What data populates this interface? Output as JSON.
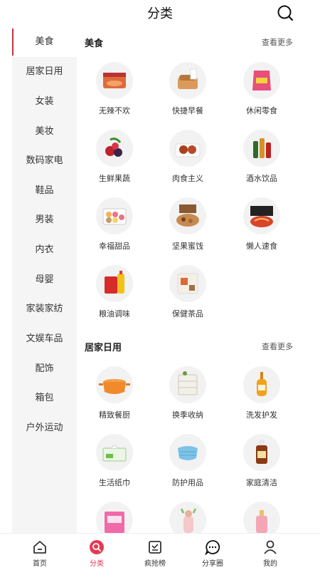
{
  "header": {
    "title": "分类"
  },
  "sidebar": {
    "items": [
      {
        "label": "美食",
        "active": true
      },
      {
        "label": "居家日用"
      },
      {
        "label": "女装"
      },
      {
        "label": "美妆"
      },
      {
        "label": "数码家电"
      },
      {
        "label": "鞋品"
      },
      {
        "label": "男装"
      },
      {
        "label": "内衣"
      },
      {
        "label": "母婴"
      },
      {
        "label": "家装家纺"
      },
      {
        "label": "文娱车品"
      },
      {
        "label": "配饰"
      },
      {
        "label": "箱包"
      },
      {
        "label": "户外运动"
      }
    ]
  },
  "sections": [
    {
      "title": "美食",
      "more": "查看更多",
      "items": [
        {
          "label": "无辣不欢",
          "icon": "spicy-food-icon"
        },
        {
          "label": "快捷早餐",
          "icon": "bread-icon"
        },
        {
          "label": "休闲零食",
          "icon": "snack-bag-icon"
        },
        {
          "label": "生鲜果蔬",
          "icon": "fruit-icon"
        },
        {
          "label": "肉食主义",
          "icon": "meatball-icon"
        },
        {
          "label": "酒水饮品",
          "icon": "bottles-icon"
        },
        {
          "label": "幸福甜品",
          "icon": "macaron-icon"
        },
        {
          "label": "坚果蜜饯",
          "icon": "nuts-icon"
        },
        {
          "label": "懒人速食",
          "icon": "instant-noodle-icon"
        },
        {
          "label": "粮油调味",
          "icon": "rice-oil-icon"
        },
        {
          "label": "保健茶品",
          "icon": "tea-box-icon"
        }
      ]
    },
    {
      "title": "居家日用",
      "more": "查看更多",
      "items": [
        {
          "label": "精致餐厨",
          "icon": "pot-icon"
        },
        {
          "label": "换季收纳",
          "icon": "drawer-icon"
        },
        {
          "label": "洗发护发",
          "icon": "shampoo-icon"
        },
        {
          "label": "生活纸巾",
          "icon": "tissue-icon"
        },
        {
          "label": "防护用品",
          "icon": "mask-icon"
        },
        {
          "label": "家庭清洁",
          "icon": "disinfectant-icon"
        },
        {
          "label": "",
          "icon": "pads-icon"
        },
        {
          "label": "",
          "icon": "cup-icon"
        },
        {
          "label": "",
          "icon": "perfume-icon"
        }
      ]
    }
  ],
  "tabbar": {
    "items": [
      {
        "label": "首页",
        "icon": "home-icon"
      },
      {
        "label": "分类",
        "icon": "category-icon",
        "active": true
      },
      {
        "label": "疯抢榜",
        "icon": "ranking-icon"
      },
      {
        "label": "分享圈",
        "icon": "chat-icon"
      },
      {
        "label": "我的",
        "icon": "user-icon"
      }
    ]
  },
  "colors": {
    "accent": "#e33a55",
    "sidebar_bg": "#f5f5f5",
    "active_marker": "#c8323c"
  }
}
